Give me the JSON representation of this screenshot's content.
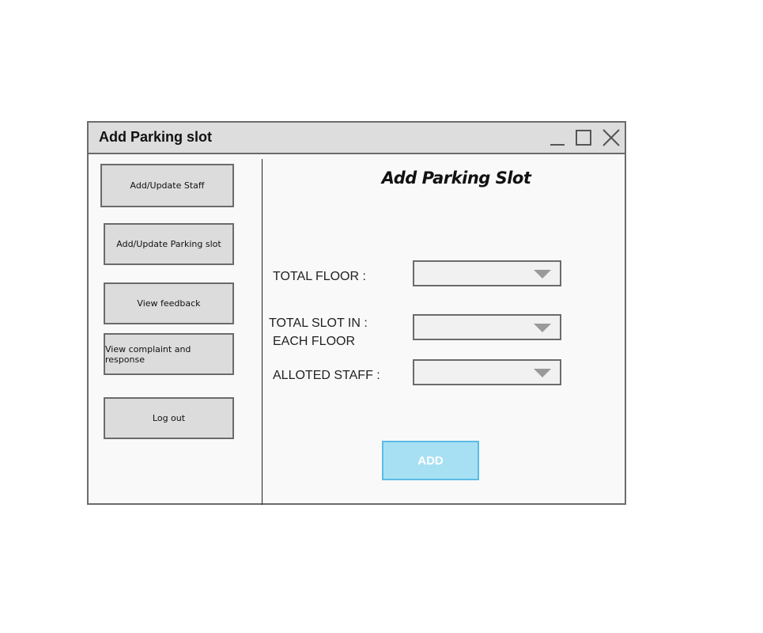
{
  "window": {
    "title": "Add Parking slot"
  },
  "sidebar": {
    "items": [
      {
        "label": "Add/Update Staff"
      },
      {
        "label": "Add/Update Parking slot"
      },
      {
        "label": "View feedback"
      },
      {
        "label": "View complaint and response"
      },
      {
        "label": "Log out"
      }
    ]
  },
  "main": {
    "title": "Add Parking Slot",
    "fields": {
      "total_floor": {
        "label": "TOTAL FLOOR :",
        "value": ""
      },
      "total_slot": {
        "label_line1": "TOTAL SLOT IN  :",
        "label_line2": "EACH FLOOR",
        "value": ""
      },
      "alloted_staff": {
        "label": "ALLOTED STAFF :",
        "value": ""
      }
    },
    "add_label": "ADD"
  },
  "colors": {
    "titlebar": "#dddddd",
    "button_bg": "#dcdcdc",
    "border": "#6b6b6b",
    "add_button_bg": "#a8e0f3",
    "add_button_border": "#5bbce3"
  },
  "icons": [
    "minimize-icon",
    "maximize-icon",
    "close-icon",
    "chevron-down-icon"
  ]
}
